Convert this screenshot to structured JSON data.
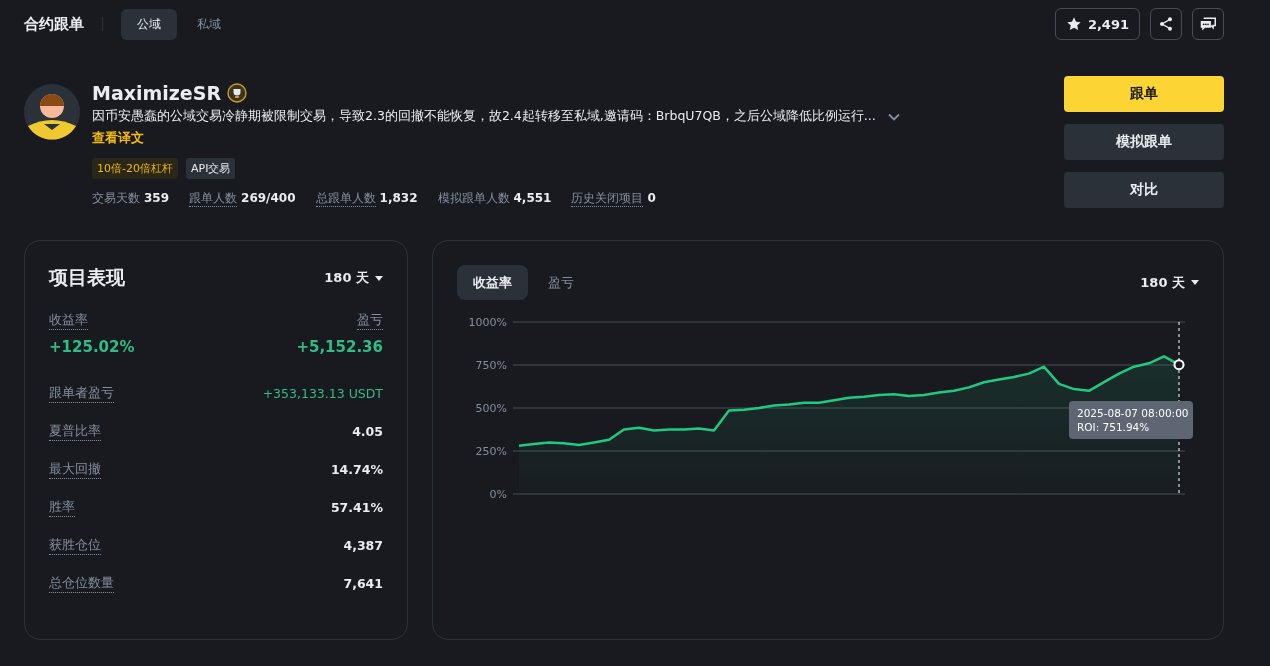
{
  "header": {
    "title": "合约跟单",
    "tabs": [
      {
        "label": "公域",
        "selected": true
      },
      {
        "label": "私域",
        "selected": false
      }
    ],
    "favorites": "2,491"
  },
  "profile": {
    "name": "MaximizeSR",
    "description": "因币安愚蠢的公域交易冷静期被限制交易，导致2.3的回撤不能恢复，故2.4起转移至私域,邀请码：BrbqU7QB，之后公域降低比例运行...",
    "translate_link": "查看译文",
    "tags": [
      {
        "label": "10倍-20倍杠杆",
        "kind": "leverage"
      },
      {
        "label": "API交易",
        "kind": "plain"
      }
    ],
    "stats": [
      {
        "label": "交易天数",
        "value": "359",
        "underlined": false
      },
      {
        "label": "跟单人数",
        "value": "269/400",
        "underlined": true
      },
      {
        "label": "总跟单人数",
        "value": "1,832",
        "underlined": true
      },
      {
        "label": "模拟跟单人数",
        "value": "4,551",
        "underlined": false
      },
      {
        "label": "历史关闭项目",
        "value": "0",
        "underlined": true
      }
    ]
  },
  "actions": [
    {
      "label": "跟单",
      "kind": "primary"
    },
    {
      "label": "模拟跟单",
      "kind": "secondary"
    },
    {
      "label": "对比",
      "kind": "secondary"
    }
  ],
  "performance": {
    "title": "项目表现",
    "period": "180 天",
    "roi_label": "收益率",
    "roi": "+125.02%",
    "pnl_label": "盈亏",
    "pnl": "+5,152.36",
    "rows": [
      {
        "label": "跟单者盈亏",
        "value": "+353,133.13 USDT",
        "positive": true
      },
      {
        "label": "夏普比率",
        "value": "4.05",
        "positive": false
      },
      {
        "label": "最大回撤",
        "value": "14.74%",
        "positive": false
      },
      {
        "label": "胜率",
        "value": "57.41%",
        "positive": false
      },
      {
        "label": "获胜仓位",
        "value": "4,387",
        "positive": false
      },
      {
        "label": "总仓位数量",
        "value": "7,641",
        "positive": false
      }
    ]
  },
  "chart_panel": {
    "tabs": [
      {
        "label": "收益率",
        "selected": true
      },
      {
        "label": "盈亏",
        "selected": false
      }
    ],
    "period": "180 天",
    "tooltip": {
      "date": "2025-08-07 08:00:00",
      "roi": "ROI: 751.94%"
    },
    "chart_data": {
      "type": "area",
      "grid": true,
      "ylim": [
        0,
        1000
      ],
      "yticks": [
        {
          "value": 0,
          "label": "0%"
        },
        {
          "value": 250,
          "label": "250%"
        },
        {
          "value": 500,
          "label": "500%"
        },
        {
          "value": 750,
          "label": "750%"
        },
        {
          "value": 1000,
          "label": "1000%"
        }
      ],
      "values": [
        280,
        290,
        300,
        295,
        285,
        300,
        315,
        375,
        385,
        370,
        375,
        375,
        380,
        370,
        485,
        490,
        500,
        515,
        520,
        530,
        530,
        545,
        560,
        565,
        575,
        580,
        570,
        575,
        590,
        600,
        620,
        650,
        665,
        680,
        700,
        740,
        640,
        610,
        600,
        650,
        700,
        740,
        760,
        800,
        752
      ]
    }
  }
}
